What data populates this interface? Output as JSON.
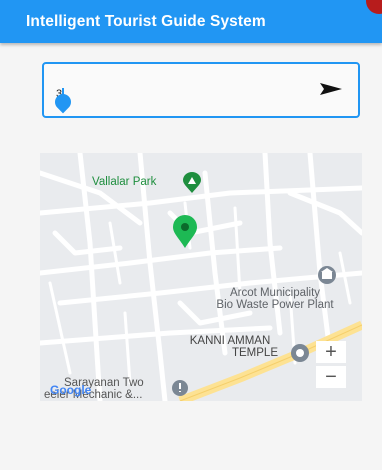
{
  "appbar": {
    "title": "Intelligent Tourist Guide System"
  },
  "search": {
    "value": "3",
    "send_icon": "send-arrow-icon"
  },
  "map": {
    "places": {
      "park": "Vallalar Park",
      "municipality_line1": "Arcot Municipality",
      "municipality_line2": "Bio Waste Power Plant",
      "temple_line1": "KANNI AMMAN",
      "temple_line2": "TEMPLE",
      "mechanic_line1": "Sarayanan Two",
      "mechanic_line2": "eeler Mechanic &..."
    },
    "zoom_in": "+",
    "zoom_out": "−",
    "logo": "Google"
  },
  "colors": {
    "primary": "#2196f3",
    "marker": "#1db954",
    "park": "#1e8e3e",
    "road_yellow": "#fde293"
  }
}
